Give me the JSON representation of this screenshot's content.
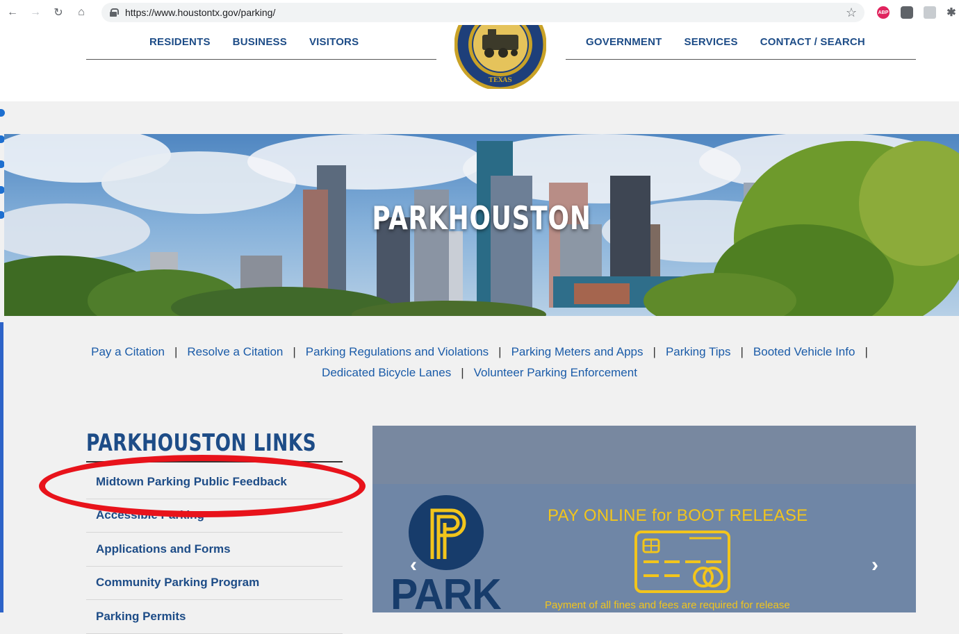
{
  "browser": {
    "url": "https://www.houstontx.gov/parking/",
    "ext_abp": "ABP"
  },
  "header": {
    "nav_left": [
      "RESIDENTS",
      "BUSINESS",
      "VISITORS"
    ],
    "nav_right": [
      "GOVERNMENT",
      "SERVICES",
      "CONTACT / SEARCH"
    ],
    "seal_text": "TEXAS"
  },
  "banner": {
    "title": "PARKHOUSTON"
  },
  "quicklinks": {
    "row1": [
      "Pay a Citation",
      "Resolve a Citation",
      "Parking Regulations and Violations",
      "Parking Meters and Apps",
      "Parking Tips",
      "Booted Vehicle Info"
    ],
    "row2": [
      "Dedicated Bicycle Lanes",
      "Volunteer Parking Enforcement"
    ],
    "separator": "|"
  },
  "sidebar": {
    "title": "PARKHOUSTON LINKS",
    "items": [
      "Midtown Parking Public Feedback",
      "Accessible Parking",
      "Applications and Forms",
      "Community Parking Program",
      "Parking Permits"
    ]
  },
  "carousel": {
    "heading": "PAY ONLINE for BOOT RELEASE",
    "caption": "Payment of all fines and fees are required for release",
    "logo_text": "PARK",
    "prev": "‹",
    "next": "›"
  },
  "colors": {
    "brand_blue": "#1d4c87",
    "link_blue": "#1a5ba8",
    "accent_yellow": "#f2c51c",
    "highlight_red": "#e8131b"
  }
}
